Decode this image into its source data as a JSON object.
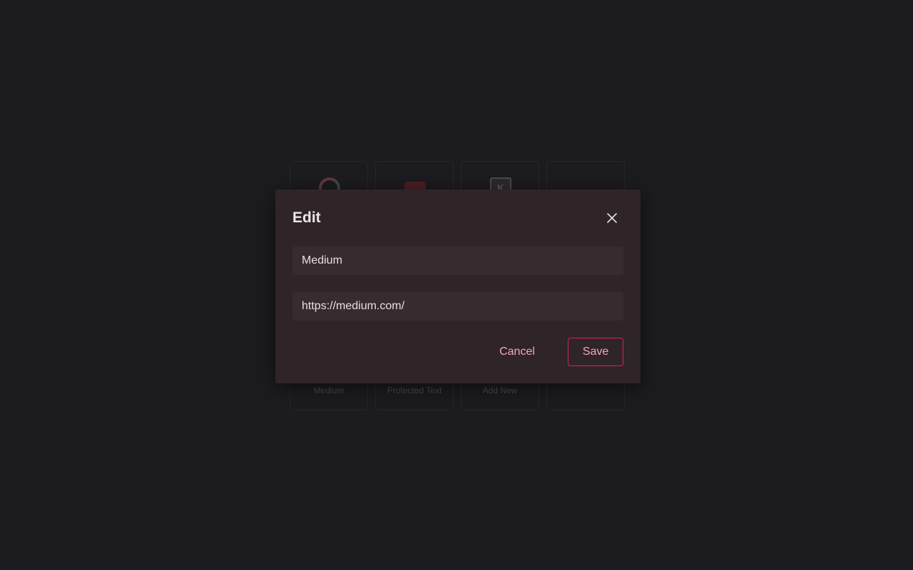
{
  "background_tiles": [
    {
      "label": "Medium",
      "icon": "google-icon"
    },
    {
      "label": "Protected Text",
      "icon": "video-icon"
    },
    {
      "label": "Add New",
      "icon": "k-box-icon",
      "glyph": "K"
    },
    {
      "label": "",
      "icon": ""
    }
  ],
  "dialog": {
    "title": "Edit",
    "close_icon": "close-icon",
    "name_field": {
      "value": "Medium"
    },
    "url_field": {
      "value": "https://medium.com/"
    },
    "cancel_label": "Cancel",
    "save_label": "Save"
  },
  "colors": {
    "page_background": "#1c1b1f",
    "dialog_background": "#2f2428",
    "field_background": "#382b30",
    "accent_text": "#f2a6c6",
    "accent_border": "#c8285f"
  }
}
